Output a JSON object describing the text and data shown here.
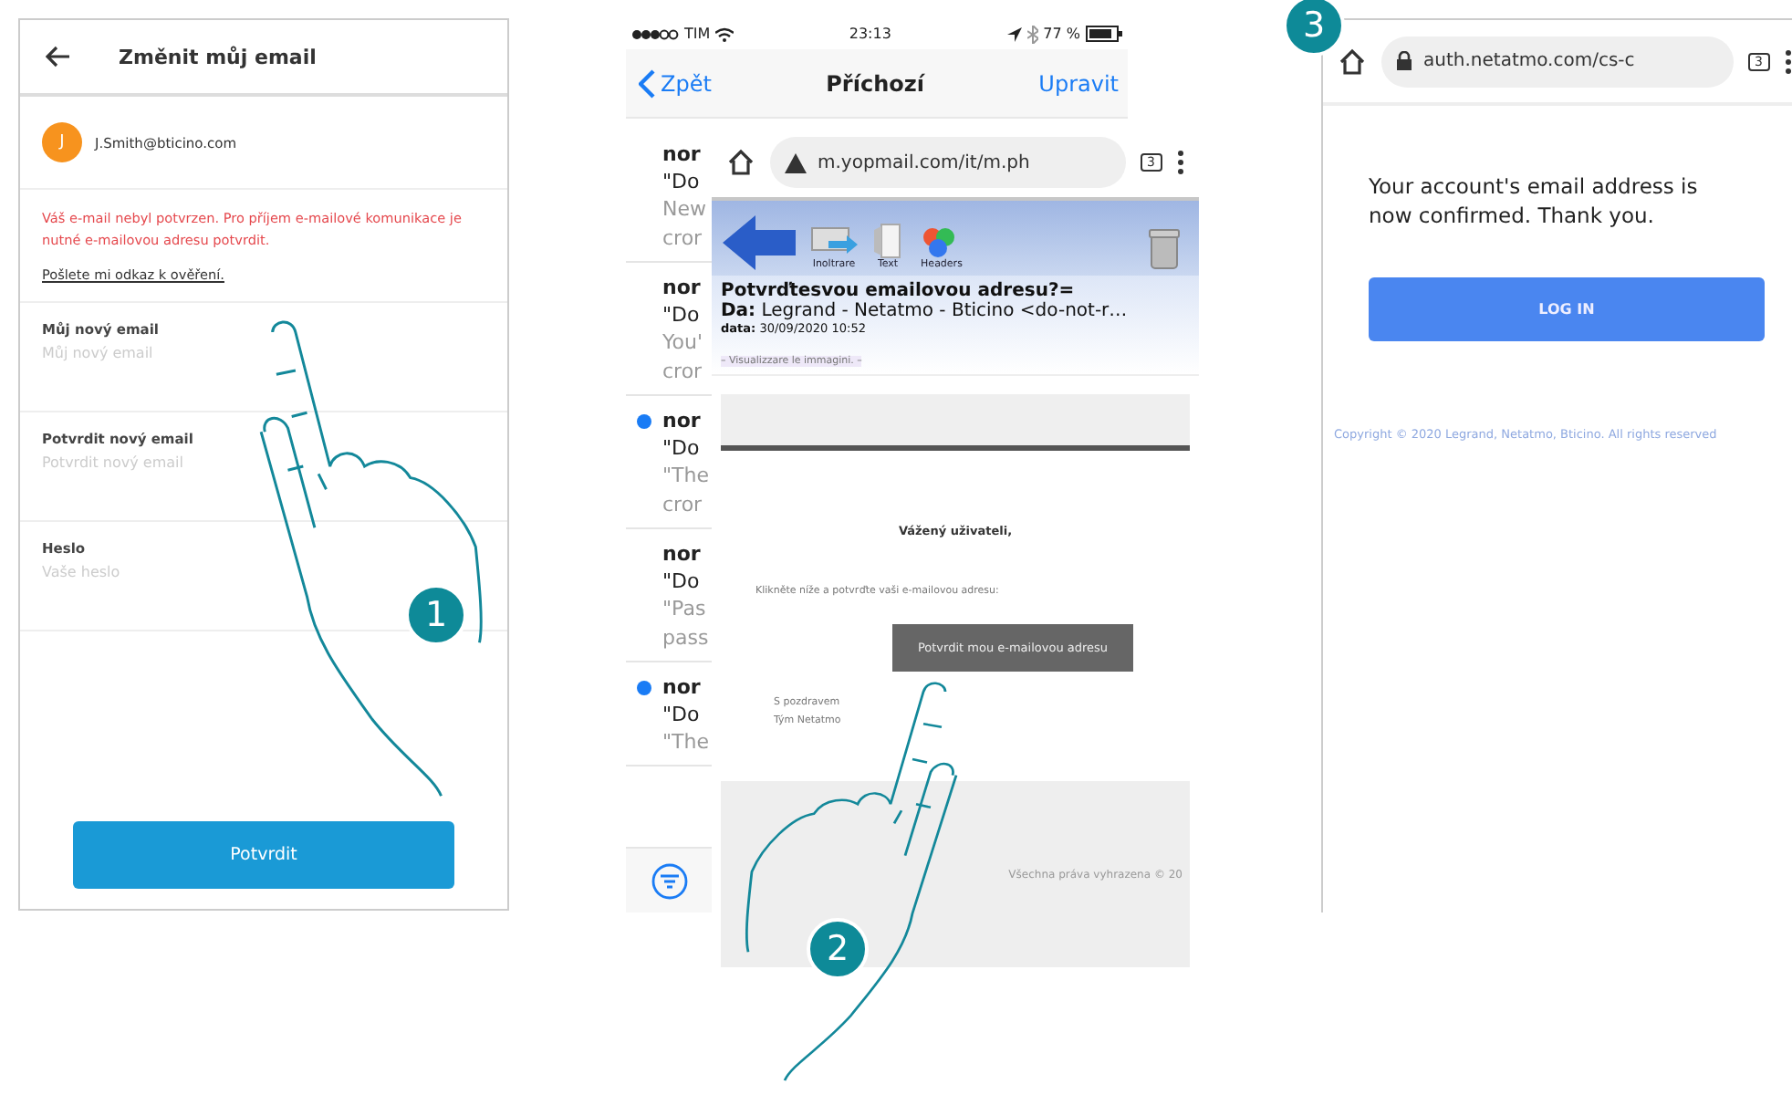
{
  "steps": [
    {
      "number": "1"
    },
    {
      "number": "2"
    },
    {
      "number": "3"
    }
  ],
  "app_screen": {
    "title": "Změnit můj email",
    "account": {
      "initial": "J",
      "email": "J.Smith@bticino.com"
    },
    "warning": "Váš e-mail nebyl potvrzen. Pro příjem e-mailové komunikace je nutné e-mailovou adresu potvrdit.",
    "verify_link": "Pošlete mi odkaz k ověření.",
    "fields": [
      {
        "label": "Můj nový email",
        "placeholder": "Můj nový email"
      },
      {
        "label": "Potvrdit nový email",
        "placeholder": "Potvrdit nový email"
      },
      {
        "label": "Heslo",
        "placeholder": "Vaše heslo"
      }
    ],
    "submit": "Potvrdit"
  },
  "mail_screen": {
    "status_bar": {
      "carrier": "TIM",
      "time": "23:13",
      "battery": "77 %"
    },
    "back": "Zpět",
    "title": "Příchozí",
    "edit": "Upravit",
    "messages": [
      {
        "sender": "nor",
        "subject": "\"Do",
        "preview": [
          "New",
          "cror"
        ],
        "unread": false
      },
      {
        "sender": "nor",
        "subject": "\"Do",
        "preview": [
          "You'",
          "cror"
        ],
        "unread": false
      },
      {
        "sender": "nor",
        "subject": "\"Do",
        "preview": [
          "\"The",
          "cror"
        ],
        "unread": true
      },
      {
        "sender": "nor",
        "subject": "\"Do",
        "preview": [
          "\"Pas",
          "pass"
        ],
        "unread": false
      },
      {
        "sender": "nor",
        "subject": "\"Do",
        "preview": [
          "\"The"
        ],
        "unread": true
      }
    ]
  },
  "browser_email": {
    "url": "m.yopmail.com/it/m.ph",
    "tab_count": "3",
    "toolbar": [
      "Inoltrare",
      "Text",
      "Headers"
    ],
    "subject": "Potvrďtesvou emailovou adresu?=",
    "from_label": "Da:",
    "from": "Legrand - Netatmo - Bticino <do-not-r…",
    "date_label": "data:",
    "date": "30/09/2020 10:52",
    "images_link": "– Visualizzare le immagini. –",
    "greeting": "Vážený uživateli,",
    "instruction": "Klikněte níže a potvrďte vaši e-mailovou adresu:",
    "confirm_button": "Potvrdit mou e-mailovou adresu",
    "signoff": [
      "S pozdravem",
      "Tým Netatmo"
    ],
    "footer": "Všechna práva vyhrazena © 20"
  },
  "browser_confirm": {
    "url": "auth.netatmo.com/cs-c",
    "tab_count": "3",
    "message": "Your account's email address is now confirmed. Thank you.",
    "login": "LOG IN",
    "copyright": "Copyright © 2020 Legrand, Netatmo, Bticino. All rights reserved"
  }
}
